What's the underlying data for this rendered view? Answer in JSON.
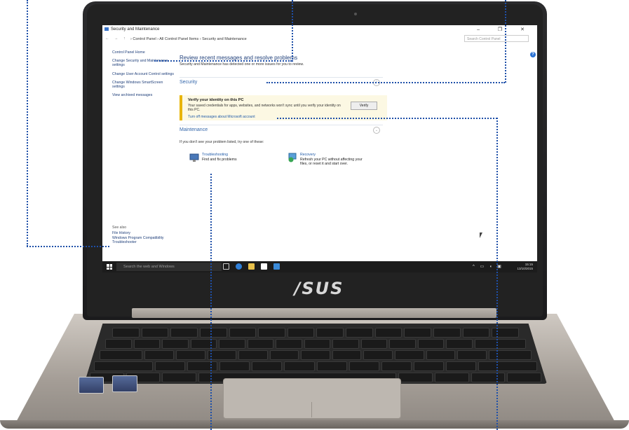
{
  "window": {
    "title": "Security and Maintenance",
    "controls": "– ❐ ✕"
  },
  "address": {
    "nav": "← → ↑",
    "breadcrumb": "› Control Panel › All Control Panel Items › Security and Maintenance",
    "search_placeholder": "Search Control Panel"
  },
  "left_pane": {
    "items": [
      "Control Panel Home",
      "Change Security and Maintenance settings",
      "Change User Account Control settings",
      "Change Windows SmartScreen settings",
      "View archived messages"
    ]
  },
  "see_also": {
    "title": "See also",
    "items": [
      "File History",
      "Windows Program Compatibility Troubleshooter"
    ]
  },
  "main": {
    "heading": "Review recent messages and resolve problems",
    "subtext": "Security and Maintenance has detected one or more issues for you to review.",
    "security_label": "Security",
    "notice_title": "Verify your identity on this PC",
    "notice_body": "Your saved credentials for apps, websites, and networks won't sync until you verify your identity on this PC.",
    "verify_button": "Verify",
    "notice_link": "Turn off messages about Microsoft account",
    "maintenance_label": "Maintenance",
    "problem_text": "If you don't see your problem listed, try one of these:",
    "troubleshooting_title": "Troubleshooting",
    "troubleshooting_desc": "Find and fix problems",
    "recovery_title": "Recovery",
    "recovery_desc": "Refresh your PC without affecting your files, or reset it and start over."
  },
  "taskbar": {
    "search_placeholder": "Search the web and Windows",
    "time": "15:15",
    "date": "13/10/2015"
  },
  "laptop": {
    "brand": "/SUS"
  },
  "colors": {
    "callout": "#1e4fa8",
    "link": "#1f5aa8",
    "notice_bar": "#e8b400"
  }
}
